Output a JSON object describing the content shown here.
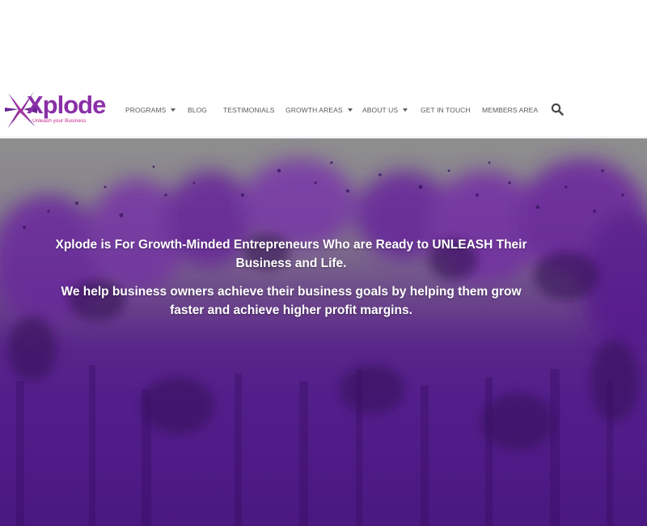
{
  "brand": {
    "logo_text": "Xplode",
    "tagline": "Unleash your Business",
    "colors": {
      "purple": "#8a2fa8",
      "magenta": "#c3278a",
      "hero_purple": "#5a1f95"
    }
  },
  "nav": {
    "items": [
      {
        "label": "PROGRAMS",
        "has_dropdown": true
      },
      {
        "label": "BLOG",
        "has_dropdown": false
      },
      {
        "label": "TESTIMONIALS",
        "has_dropdown": false
      },
      {
        "label": "GROWTH AREAS",
        "has_dropdown": true
      },
      {
        "label": "ABOUT US",
        "has_dropdown": true
      },
      {
        "label": "GET IN TOUCH",
        "has_dropdown": false
      },
      {
        "label": "MEMBERS AREA",
        "has_dropdown": false
      }
    ],
    "search_icon": "search-icon"
  },
  "hero": {
    "headline": "Xplode is For Growth-Minded Entrepreneurs Who are Ready to UNLEASH Their Business and Life.",
    "subline": "We help business owners achieve their business goals by helping them grow faster and achieve higher profit margins."
  }
}
